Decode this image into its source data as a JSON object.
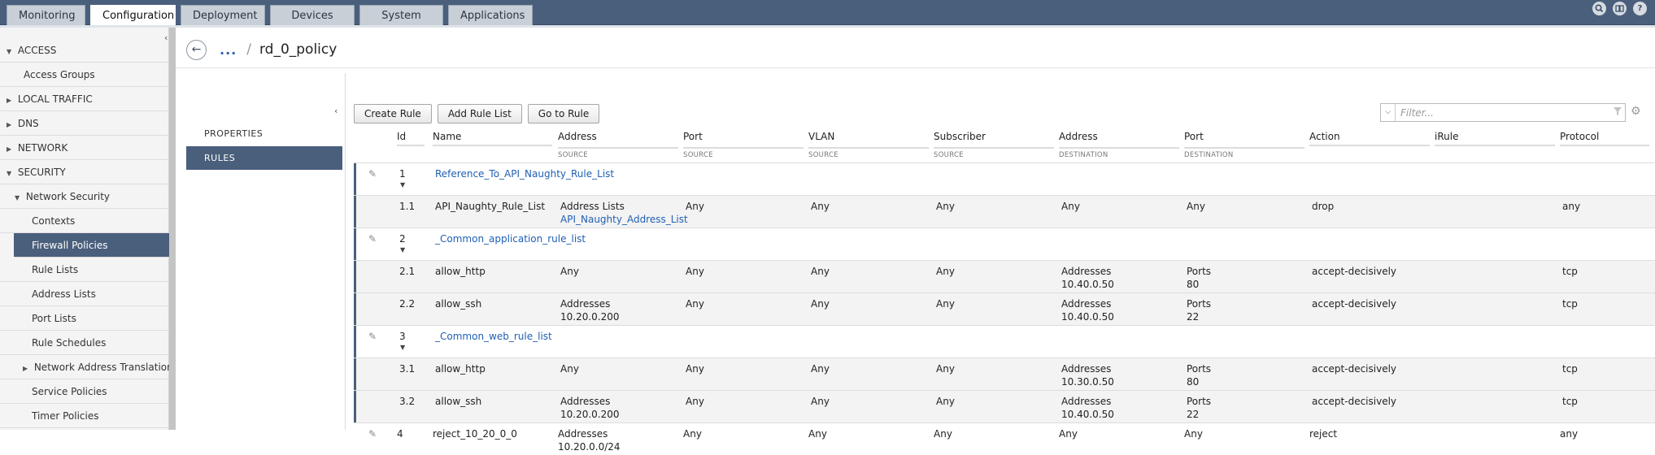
{
  "top_tabs": [
    "Monitoring",
    "Configuration",
    "Deployment",
    "Devices",
    "System",
    "Applications"
  ],
  "top_icons": {
    "search": "search-icon",
    "book": "book-icon",
    "help": "help-icon",
    "help_glyph": "?"
  },
  "nav": {
    "access": "ACCESS",
    "access_groups": "Access Groups",
    "local_traffic": "LOCAL TRAFFIC",
    "dns": "DNS",
    "network": "NETWORK",
    "security": "SECURITY",
    "network_security": "Network Security",
    "contexts": "Contexts",
    "firewall_policies": "Firewall Policies",
    "rule_lists": "Rule Lists",
    "address_lists": "Address Lists",
    "port_lists": "Port Lists",
    "rule_schedules": "Rule Schedules",
    "nat": "Network Address Translation",
    "service_policies": "Service Policies",
    "timer_policies": "Timer Policies"
  },
  "breadcrumb": {
    "ellipsis": "...",
    "separator": "/",
    "title": "rd_0_policy"
  },
  "subnav": {
    "properties": "PROPERTIES",
    "rules": "RULES"
  },
  "toolbar": {
    "create_rule": "Create Rule",
    "add_rule_list": "Add Rule List",
    "go_to_rule": "Go to Rule"
  },
  "filter": {
    "placeholder": "Filter..."
  },
  "columns": {
    "id": "Id",
    "name": "Name",
    "src_address": "Address",
    "src_address_sub": "SOURCE",
    "src_port": "Port",
    "src_port_sub": "SOURCE",
    "vlan": "VLAN",
    "vlan_sub": "SOURCE",
    "subscriber": "Subscriber",
    "subscriber_sub": "SOURCE",
    "dst_address": "Address",
    "dst_address_sub": "DESTINATION",
    "dst_port": "Port",
    "dst_port_sub": "DESTINATION",
    "action": "Action",
    "irule": "iRule",
    "protocol": "Protocol"
  },
  "rows": {
    "r1": {
      "id": "1",
      "name": "Reference_To_API_Naughty_Rule_List"
    },
    "r11": {
      "id": "1.1",
      "name": "API_Naughty_Rule_List",
      "src": "Address Lists",
      "src2": "API_Naughty_Address_List",
      "sport": "Any",
      "vlan": "Any",
      "sub": "Any",
      "dst": "Any",
      "dport": "Any",
      "action": "drop",
      "proto": "any"
    },
    "r2": {
      "id": "2",
      "name": "_Common_application_rule_list"
    },
    "r21": {
      "id": "2.1",
      "name": "allow_http",
      "src": "Any",
      "sport": "Any",
      "vlan": "Any",
      "sub": "Any",
      "dst": "Addresses",
      "dst2": "10.40.0.50",
      "dport": "Ports",
      "dport2": "80",
      "action": "accept-decisively",
      "proto": "tcp"
    },
    "r22": {
      "id": "2.2",
      "name": "allow_ssh",
      "src": "Addresses",
      "src2": "10.20.0.200",
      "sport": "Any",
      "vlan": "Any",
      "sub": "Any",
      "dst": "Addresses",
      "dst2": "10.40.0.50",
      "dport": "Ports",
      "dport2": "22",
      "action": "accept-decisively",
      "proto": "tcp"
    },
    "r3": {
      "id": "3",
      "name": "_Common_web_rule_list"
    },
    "r31": {
      "id": "3.1",
      "name": "allow_http",
      "src": "Any",
      "sport": "Any",
      "vlan": "Any",
      "sub": "Any",
      "dst": "Addresses",
      "dst2": "10.30.0.50",
      "dport": "Ports",
      "dport2": "80",
      "action": "accept-decisively",
      "proto": "tcp"
    },
    "r32": {
      "id": "3.2",
      "name": "allow_ssh",
      "src": "Addresses",
      "src2": "10.20.0.200",
      "sport": "Any",
      "vlan": "Any",
      "sub": "Any",
      "dst": "Addresses",
      "dst2": "10.40.0.50",
      "dport": "Ports",
      "dport2": "22",
      "action": "accept-decisively",
      "proto": "tcp"
    },
    "r4": {
      "id": "4",
      "name": "reject_10_20_0_0",
      "src": "Addresses",
      "src2": "10.20.0.0/24",
      "sport": "Any",
      "vlan": "Any",
      "sub": "Any",
      "dst": "Any",
      "dport": "Any",
      "action": "reject",
      "proto": "any"
    }
  },
  "colors": {
    "accent": "#4a5f7c",
    "link": "#1f5fb3"
  }
}
